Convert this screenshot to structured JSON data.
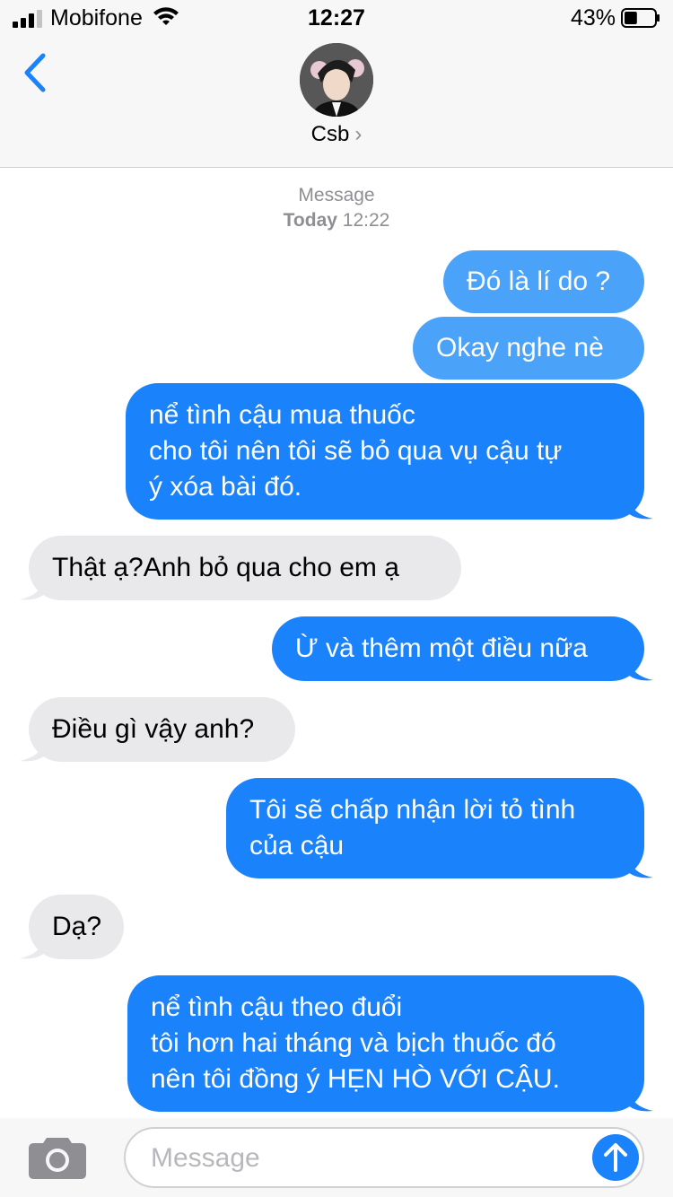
{
  "status_bar": {
    "carrier": "Mobifone",
    "time": "12:27",
    "battery_percent": "43%",
    "battery_level": 0.43
  },
  "header": {
    "contact_name": "Csb",
    "back_icon": "chevron-left-icon",
    "avatar": "contact-photo"
  },
  "conversation": {
    "service": "Message",
    "day": "Today",
    "time": "12:22",
    "messages": [
      {
        "from": "me",
        "text": "Đó là lí do ?"
      },
      {
        "from": "me",
        "text": "Okay nghe nè"
      },
      {
        "from": "me",
        "text": "nể tình cậu mua thuốc\ncho tôi nên tôi sẽ bỏ qua vụ cậu tự\ný xóa bài đó."
      },
      {
        "from": "them",
        "text": "Thật ạ?Anh bỏ qua cho em ạ"
      },
      {
        "from": "me",
        "text": "Ừ và thêm một điều nữa"
      },
      {
        "from": "them",
        "text": "Điều gì vậy anh?"
      },
      {
        "from": "me",
        "text": "Tôi sẽ chấp nhận lời tỏ tình\ncủa cậu"
      },
      {
        "from": "them",
        "text": "Dạ?"
      },
      {
        "from": "me",
        "text": "nể tình cậu theo đuổi\ntôi hơn hai tháng và bịch thuốc đó\nnên tôi đồng ý HẸN HÒ VỚI CẬU."
      }
    ]
  },
  "composer": {
    "placeholder": "Message",
    "camera_icon": "camera-icon",
    "send_icon": "arrow-up-icon"
  },
  "colors": {
    "outgoing": "#1a82fb",
    "outgoing_light": "#4ba2f9",
    "incoming": "#e9e9eb",
    "accent": "#1a82fb"
  }
}
